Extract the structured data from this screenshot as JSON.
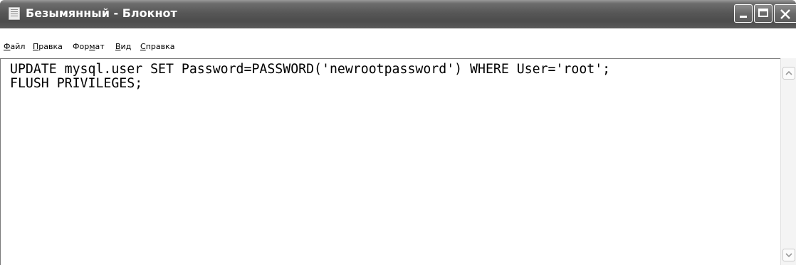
{
  "window": {
    "title": "Безымянный - Блокнот",
    "icon": "notepad-icon"
  },
  "caption_buttons": {
    "minimize_icon": "minimize-icon",
    "maximize_icon": "maximize-icon",
    "close_icon": "close-icon"
  },
  "menu": {
    "items": [
      {
        "hotkey": "Ф",
        "rest": "айл"
      },
      {
        "hotkey": "П",
        "rest": "равка"
      },
      {
        "pre": "Фор",
        "hotkey": "м",
        "rest": "ат"
      },
      {
        "hotkey": "В",
        "rest": "ид"
      },
      {
        "hotkey": "С",
        "rest": "правка"
      }
    ]
  },
  "editor": {
    "lines": [
      "UPDATE mysql.user SET Password=PASSWORD('newrootpassword') WHERE User='root';",
      "FLUSH PRIVILEGES;"
    ]
  },
  "scrollbar": {
    "up_icon": "scroll-up-arrow-icon",
    "down_icon": "scroll-down-arrow-icon"
  },
  "colors": {
    "titlebar": "#5a5a5a",
    "title_text": "#ffffff",
    "background": "#ffffff",
    "text": "#000000"
  }
}
